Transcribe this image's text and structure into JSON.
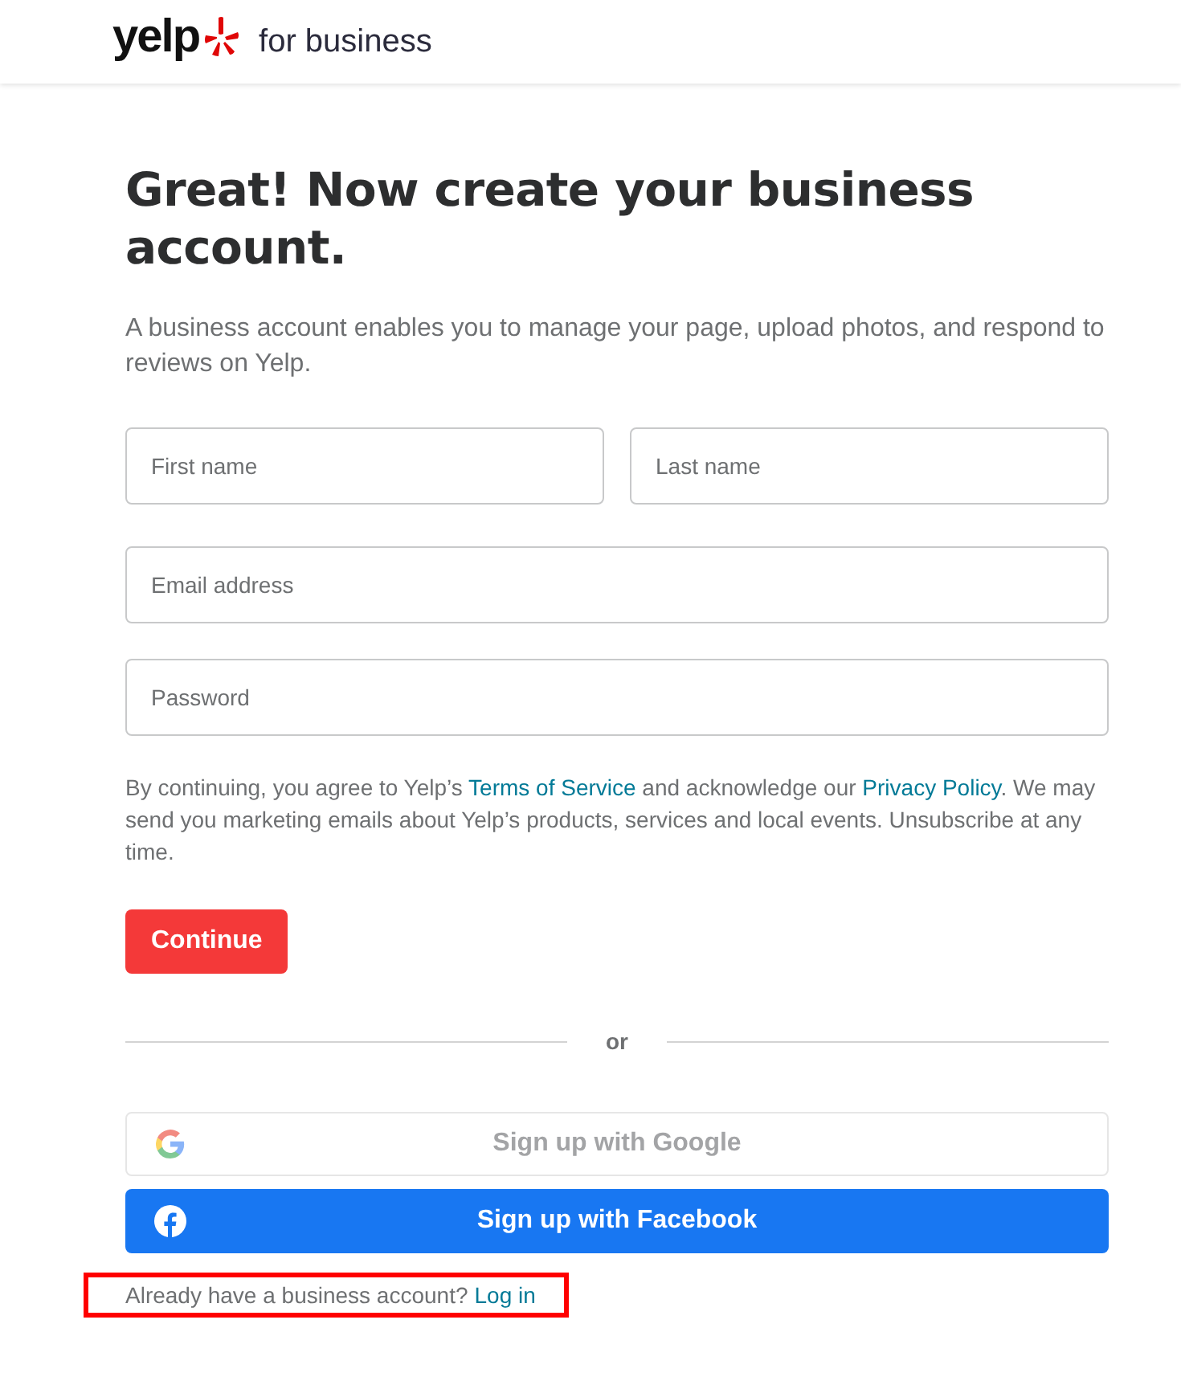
{
  "header": {
    "logo_text": "yelp",
    "tagline": "for business"
  },
  "title": "Great! Now create your business account.",
  "subtitle": "A business account enables you to manage your page, upload photos, and respond to reviews on Yelp.",
  "name_fields": [
    {
      "placeholder": "First name"
    },
    {
      "placeholder": "Last name"
    }
  ],
  "fields": [
    {
      "placeholder": "Email address"
    },
    {
      "placeholder": "Password"
    }
  ],
  "legal": [
    {
      "kind": "text",
      "text": "By continuing, you agree to Yelp’s "
    },
    {
      "kind": "link",
      "text": "Terms of Service"
    },
    {
      "kind": "text",
      "text": " and acknowledge our "
    },
    {
      "kind": "link",
      "text": "Privacy Policy"
    },
    {
      "kind": "text",
      "text": ". We may send you marketing emails about Yelp’s products, services and local events. Unsubscribe at any time."
    }
  ],
  "continue_button": "Continue",
  "divider_text": "or",
  "social_buttons": [
    {
      "kind": "google",
      "label": "Sign up with Google"
    },
    {
      "kind": "facebook",
      "label": "Sign up with Facebook"
    }
  ],
  "login": {
    "prompt": "Already have a business account?",
    "link": "Log in",
    "highlighted": true
  }
}
